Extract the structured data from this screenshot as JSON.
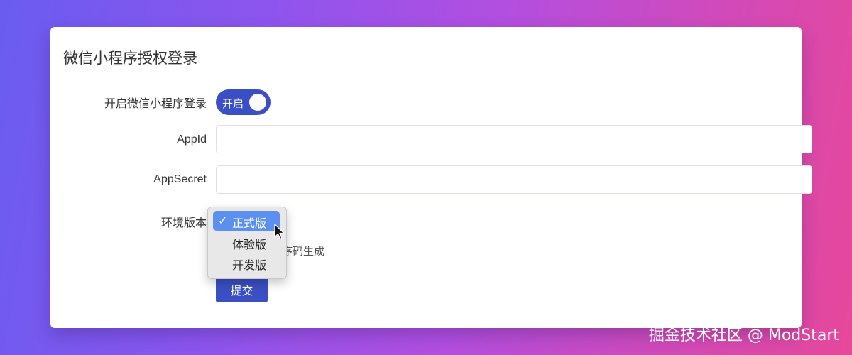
{
  "card": {
    "title": "微信小程序授权登录"
  },
  "form": {
    "enable_label": "开启微信小程序登录",
    "enable_toggle_text": "开启",
    "appid_label": "AppId",
    "appid_value": "",
    "appsecret_label": "AppSecret",
    "appsecret_value": "",
    "env_label": "环境版本",
    "env_help_visible": "序码生成",
    "submit_label": "提交"
  },
  "dropdown": {
    "check_mark": "✓",
    "options": [
      "正式版",
      "体验版",
      "开发版"
    ],
    "selected": "正式版"
  },
  "watermark": "掘金技术社区 @ ModStart",
  "colors": {
    "primary": "#3a4fc3",
    "selected_option": "#5b8ff0"
  }
}
